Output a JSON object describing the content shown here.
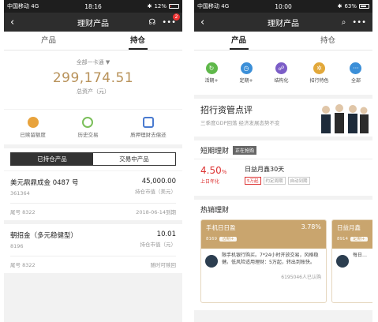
{
  "left": {
    "status": {
      "carrier": "中国移动",
      "network": "4G",
      "time": "18:16",
      "battery": "12%",
      "battery_level": 0.12
    },
    "nav": {
      "back": "‹",
      "title": "理财产品",
      "headset_icon": "headset-icon",
      "more_icon": "more-icon",
      "badge": "2"
    },
    "tabs": [
      {
        "label": "产品",
        "active": false
      },
      {
        "label": "持仓",
        "active": true
      }
    ],
    "summary": {
      "card_select": "全部一卡通 ▼",
      "total": "299,174.51",
      "total_label": "总资产（元）"
    },
    "quick": [
      {
        "label": "已赎留额度",
        "icon": "coin-icon",
        "color": "#e8a33d"
      },
      {
        "label": "历史交易",
        "icon": "clock-icon",
        "color": "#7bbf5a"
      },
      {
        "label": "质押理财去偿还",
        "icon": "document-icon",
        "color": "#4a7bd0"
      }
    ],
    "segment": {
      "held": "已持仓产品",
      "trading": "交易中产品"
    },
    "holdings": [
      {
        "name": "美元鼎鼎成金 0487 号",
        "code": "361364",
        "amount": "45,000.00",
        "sub": "持仓市值（美元）",
        "tail": "尾号 8322",
        "due": "2018-06-14到期"
      },
      {
        "name": "朝招金（多元稳健型）",
        "code": "8196",
        "amount": "10.01",
        "sub": "持仓市值（元）",
        "tail": "尾号 8322",
        "due": "随时可赎回"
      }
    ]
  },
  "right": {
    "status": {
      "carrier": "中国移动",
      "network": "4G",
      "time": "10:00",
      "battery": "63%",
      "battery_level": 0.63
    },
    "nav": {
      "back": "‹",
      "title": "理财产品",
      "search_icon": "search-icon",
      "more_icon": "more-icon"
    },
    "tabs": [
      {
        "label": "产品",
        "active": true
      },
      {
        "label": "持仓",
        "active": false
      }
    ],
    "menu": [
      {
        "label": "活期+",
        "icon": "recycle-icon",
        "color": "#5fb84a"
      },
      {
        "label": "定期+",
        "icon": "stopwatch-icon",
        "color": "#3b8fd8"
      },
      {
        "label": "结构化",
        "icon": "structure-icon",
        "color": "#7b5dc7"
      },
      {
        "label": "招行特色",
        "icon": "gear-icon",
        "color": "#e2a83a"
      },
      {
        "label": "全部",
        "icon": "dots-icon",
        "color": "#3b8fd8"
      }
    ],
    "banner": {
      "title": "招行资管点评",
      "subtitle": "三季度GDP回落 经济发展态势不变"
    },
    "short_term": {
      "title": "短期理财",
      "tag": "正在抢购",
      "rate": "4.50",
      "rate_unit": "%",
      "rate_label": "上日年化",
      "product": "日益月鑫30天",
      "tags": [
        "5万起",
        "约定周期",
        "自动到期"
      ]
    },
    "hot": {
      "title": "热销理财",
      "cards": [
        {
          "name": "手机日日盈",
          "rate": "3.78%",
          "code": "8169",
          "chip": "活期+",
          "desc": "限手机银行购买。7*24小时开放交易，风格稳健。低风险适用理财：5万起，转出到账快。",
          "count": "6195046人已认购"
        },
        {
          "name": "日益月鑫",
          "rate": "",
          "code": "8914",
          "chip": "定期+",
          "desc": "每日…",
          "count": ""
        }
      ]
    }
  }
}
